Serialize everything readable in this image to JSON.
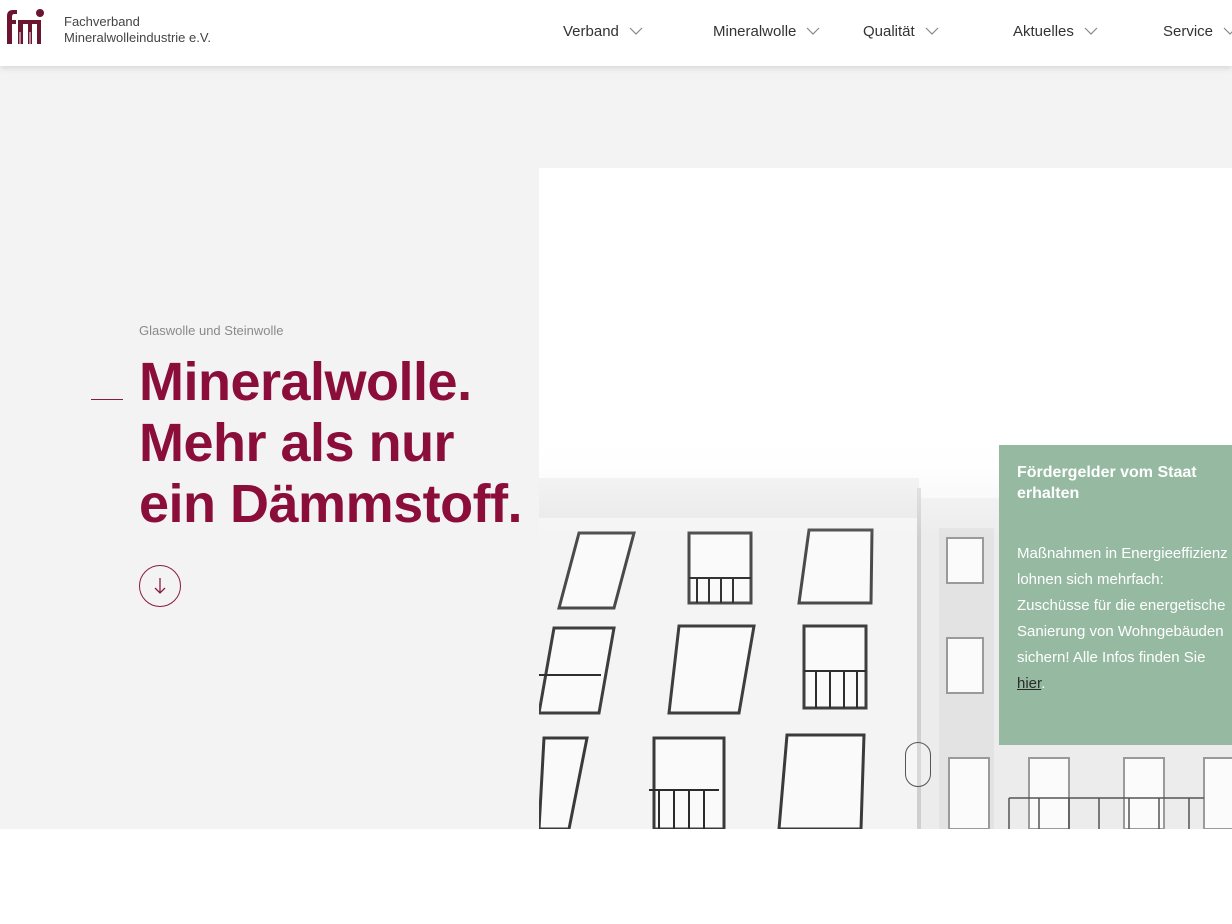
{
  "brand": {
    "line1": "Fachverband",
    "line2": "Mineralwolleindustrie e.V.",
    "color": "#6b1530"
  },
  "nav": {
    "items": [
      {
        "label": "Verband"
      },
      {
        "label": "Mineralwolle"
      },
      {
        "label": "Qualität"
      },
      {
        "label": "Aktuelles"
      },
      {
        "label": "Service"
      }
    ]
  },
  "hero": {
    "eyebrow": "Glaswolle und Steinwolle",
    "headline": [
      "Mineralwolle.",
      "Mehr als nur",
      "ein Dämmstoff."
    ],
    "accent": "#8b0e3a",
    "scroll_icon": "arrow-down-icon"
  },
  "promo": {
    "title": "Fördergelder vom Staat erhalten",
    "text_before": "Maßnahmen in Energieeffizienz lohnen sich mehrfach: Zuschüsse für die energetische Sanierung von Wohngebäuden sichern! Alle Infos finden Sie ",
    "link_label": "hier",
    "text_after": ".",
    "background": "#96b9a2"
  }
}
